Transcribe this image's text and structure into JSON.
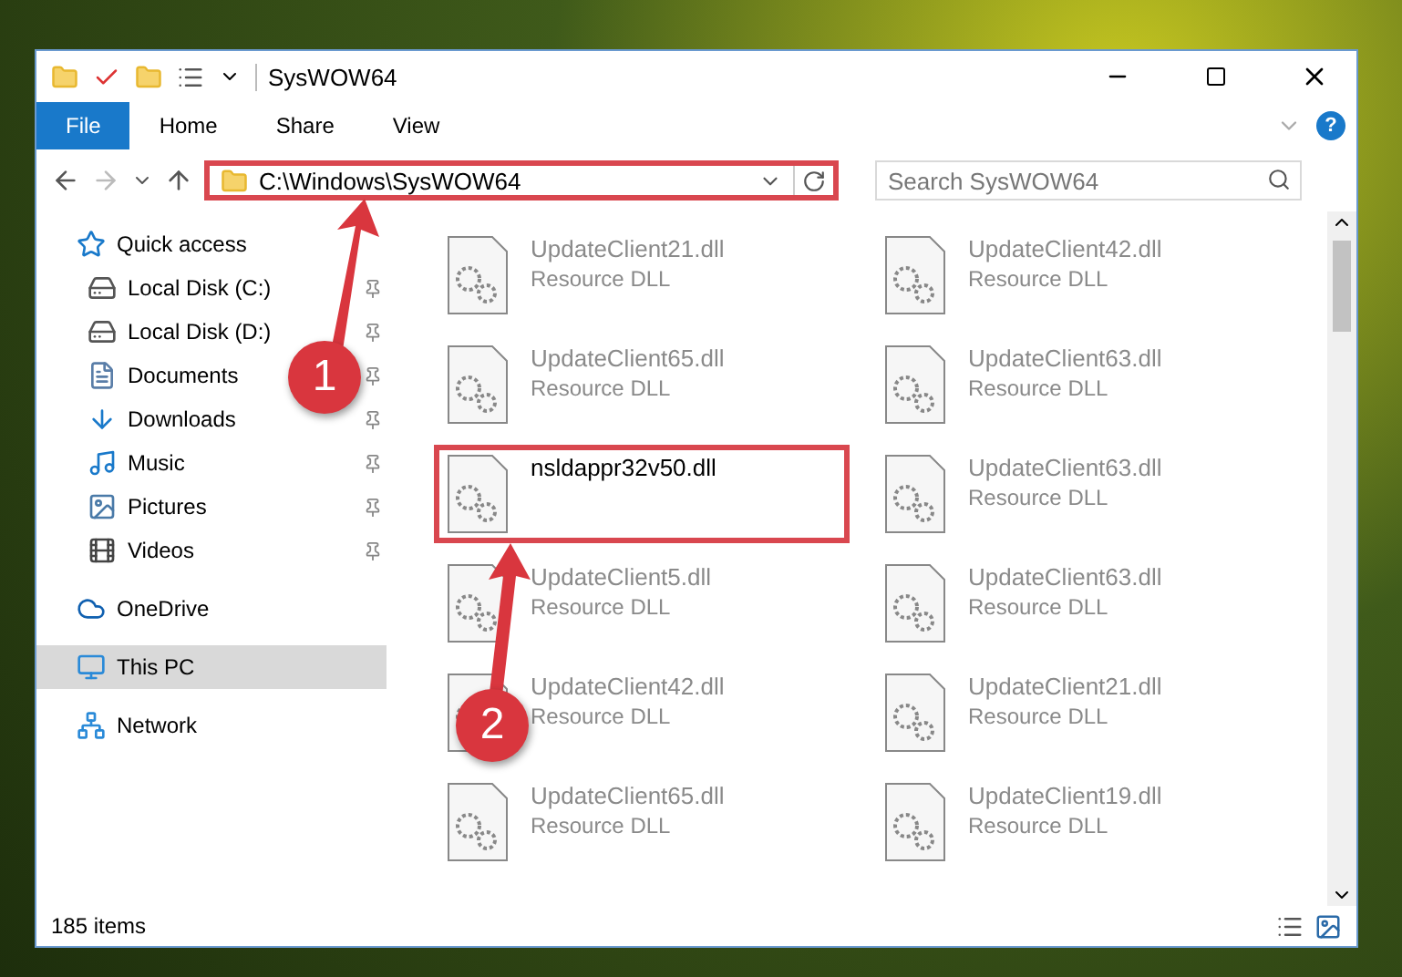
{
  "window": {
    "title": "SysWOW64"
  },
  "ribbon": {
    "tabs": [
      {
        "label": "File",
        "kind": "file"
      },
      {
        "label": "Home",
        "kind": "tab"
      },
      {
        "label": "Share",
        "kind": "tab"
      },
      {
        "label": "View",
        "kind": "tab"
      }
    ],
    "help": "?"
  },
  "address_bar": {
    "path": "C:\\Windows\\SysWOW64",
    "highlighted": true
  },
  "search": {
    "placeholder": "Search SysWOW64"
  },
  "sidebar": {
    "items": [
      {
        "label": "Quick access",
        "children": [
          {
            "label": "Local Disk (C:)",
            "pinned": true
          },
          {
            "label": "Local Disk (D:)",
            "pinned": true
          },
          {
            "label": "Documents",
            "pinned": true
          },
          {
            "label": "Downloads",
            "pinned": true
          },
          {
            "label": "Music",
            "pinned": true
          },
          {
            "label": "Pictures",
            "pinned": true
          },
          {
            "label": "Videos",
            "pinned": true
          }
        ]
      },
      {
        "label": "OneDrive",
        "selected": false
      },
      {
        "label": "This PC",
        "selected": true
      },
      {
        "label": "Network",
        "selected": false
      }
    ]
  },
  "files": [
    {
      "name": "UpdateClient21.dll",
      "type": "Resource DLL",
      "blurred": true,
      "highlighted": false
    },
    {
      "name": "UpdateClient42.dll",
      "type": "Resource DLL",
      "blurred": true,
      "highlighted": false
    },
    {
      "name": "UpdateClient65.dll",
      "type": "Resource DLL",
      "blurred": true,
      "highlighted": false
    },
    {
      "name": "UpdateClient63.dll",
      "type": "Resource DLL",
      "blurred": true,
      "highlighted": false
    },
    {
      "name": "nsldappr32v50.dll",
      "blurred": false,
      "highlighted": true
    },
    {
      "name": "UpdateClient63.dll",
      "type": "Resource DLL",
      "blurred": true,
      "highlighted": false
    },
    {
      "name": "UpdateClient5.dll",
      "type": "Resource DLL",
      "blurred": true,
      "highlighted": false
    },
    {
      "name": "UpdateClient63.dll",
      "type": "Resource DLL",
      "blurred": true,
      "highlighted": false
    },
    {
      "name": "UpdateClient42.dll",
      "type": "Resource DLL",
      "blurred": true,
      "highlighted": false
    },
    {
      "name": "UpdateClient21.dll",
      "type": "Resource DLL",
      "blurred": true,
      "highlighted": false
    },
    {
      "name": "UpdateClient65.dll",
      "type": "Resource DLL",
      "blurred": true,
      "highlighted": false
    },
    {
      "name": "UpdateClient19.dll",
      "type": "Resource DLL",
      "blurred": true,
      "highlighted": false
    }
  ],
  "status_bar": {
    "count": "185 items"
  },
  "annotations": [
    {
      "number": "1"
    },
    {
      "number": "2"
    }
  ]
}
